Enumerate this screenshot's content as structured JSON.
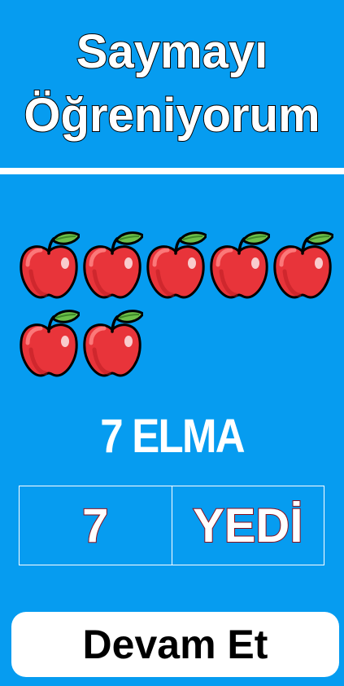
{
  "header": {
    "title_line1": "Saymayı",
    "title_line2": "Öğreniyorum"
  },
  "counting": {
    "object_icon": "apple-icon",
    "object_count": 7,
    "count_label": "7 ELMA"
  },
  "answer": {
    "digit": "7",
    "word": "YEDİ"
  },
  "actions": {
    "continue_label": "Devam Et"
  },
  "colors": {
    "background": "#069cf0",
    "apple_red": "#e8343a",
    "leaf_green": "#6cc04a",
    "outline": "#000000",
    "answer_outline": "#8b0d1a",
    "button": "#ffffff"
  }
}
